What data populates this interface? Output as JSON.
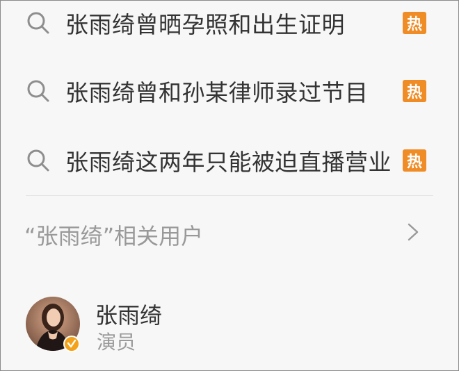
{
  "suggestions": [
    {
      "text": "张雨绮曾晒孕照和出生证明",
      "badge": "热"
    },
    {
      "text": "张雨绮曾和孙某律师录过节目",
      "badge": "热"
    },
    {
      "text": "张雨绮这两年只能被迫直播营业",
      "badge": "热"
    }
  ],
  "icons": {
    "search": "search-icon",
    "chevron": "chevron-right-icon",
    "verified": "verified-badge-icon"
  },
  "related_users": {
    "title": "“张雨绮”相关用户",
    "users": [
      {
        "name": "张雨绮",
        "description": "演员"
      }
    ]
  },
  "colors": {
    "hot_badge": "#f08c26",
    "verified_badge": "#f4a21a",
    "primary_text": "#333333",
    "secondary_text": "#999999"
  }
}
